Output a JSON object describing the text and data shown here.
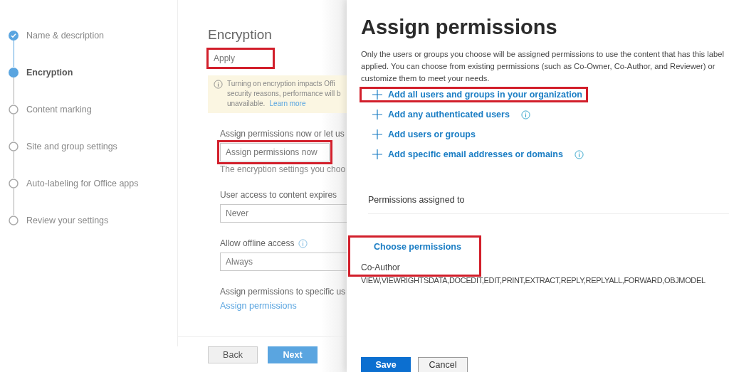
{
  "wizard_steps": [
    {
      "label": "Name & description",
      "completed": true,
      "selected": false
    },
    {
      "label": "Encryption",
      "completed": false,
      "selected": true
    },
    {
      "label": "Content marking",
      "completed": false,
      "selected": false
    },
    {
      "label": "Site and group settings",
      "completed": false,
      "selected": false
    },
    {
      "label": "Auto-labeling for Office apps",
      "completed": false,
      "selected": false
    },
    {
      "label": "Review your settings",
      "completed": false,
      "selected": false
    }
  ],
  "encryption_form": {
    "title": "Encryption",
    "apply_field": {
      "value": "Apply",
      "highlighted": true
    },
    "notice": {
      "lines": [
        "Turning on encryption impacts Offi",
        "security reasons, performance will b",
        "unavailable."
      ],
      "link": "Learn more"
    },
    "assign_label": "Assign permissions now or let us",
    "assign_field": {
      "value": "Assign permissions now",
      "highlighted": true
    },
    "assign_help": "The encryption settings you choo",
    "expires_label": "User access to content expires",
    "expires_field": {
      "value": "Never"
    },
    "offline_label": "Allow offline access",
    "offline_field": {
      "value": "Always"
    },
    "specific_label": "Assign permissions to specific us",
    "specific_link": "Assign permissions",
    "buttons": [
      {
        "label": "Back",
        "kind": "secondary"
      },
      {
        "label": "Next",
        "kind": "primary"
      }
    ]
  },
  "assign_panel": {
    "title": "Assign permissions",
    "description": "Only the users or groups you choose will be assigned permissions to use the content that has this label applied. You can choose from existing permissions (such as Co-Owner, Co-Author, and Reviewer) or customize them to meet your needs.",
    "add_links": [
      {
        "label": "Add all users and groups in your organization",
        "info": false,
        "highlighted": true
      },
      {
        "label": "Add any authenticated users",
        "info": true,
        "highlighted": false
      },
      {
        "label": "Add users or groups",
        "info": false,
        "highlighted": false
      },
      {
        "label": "Add specific email addresses or domains",
        "info": true,
        "highlighted": false
      }
    ],
    "assigned_heading": "Permissions assigned to",
    "choose": {
      "link": "Choose permissions",
      "role": "Co-Author",
      "highlighted": true
    },
    "rights": "VIEW,VIEWRIGHTSDATA,DOCEDIT,EDIT,PRINT,EXTRACT,REPLY,REPLYALL,FORWARD,OBJMODEL",
    "buttons": [
      {
        "label": "Save",
        "kind": "primary"
      },
      {
        "label": "Cancel",
        "kind": "secondary"
      }
    ]
  }
}
